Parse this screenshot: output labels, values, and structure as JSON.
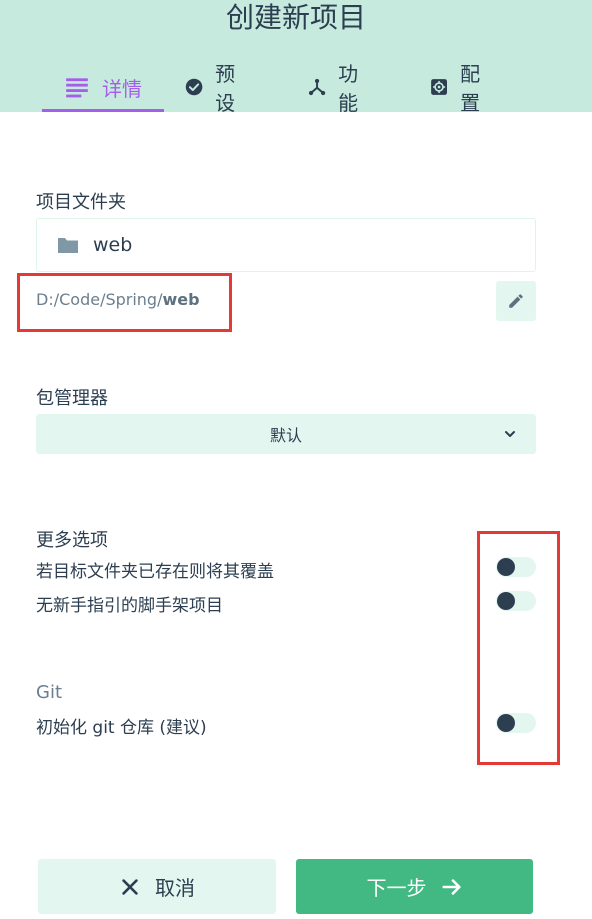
{
  "header": {
    "title": "创建新项目",
    "tabs": [
      {
        "label": "详情",
        "icon": "list-icon",
        "active": true
      },
      {
        "label": "预设",
        "icon": "check-circle-icon",
        "active": false
      },
      {
        "label": "功能",
        "icon": "branch-icon",
        "active": false
      },
      {
        "label": "配置",
        "icon": "settings-icon",
        "active": false
      }
    ]
  },
  "folder": {
    "section_label": "项目文件夹",
    "value": "web",
    "path_prefix": "D:/Code/Spring/",
    "path_name": "web"
  },
  "package_manager": {
    "section_label": "包管理器",
    "selected": "默认"
  },
  "more_options": {
    "section_label": "更多选项",
    "items": [
      {
        "label": "若目标文件夹已存在则将其覆盖",
        "enabled": false
      },
      {
        "label": "无新手指引的脚手架项目",
        "enabled": false
      }
    ]
  },
  "git": {
    "section_label": "Git",
    "items": [
      {
        "label": "初始化 git 仓库 (建议)",
        "enabled": false
      }
    ]
  },
  "actions": {
    "cancel_label": "取消",
    "next_label": "下一步"
  },
  "colors": {
    "header_bg": "#c6ebde",
    "accent": "#a55eea",
    "primary": "#42b983",
    "light": "#e3f6ef",
    "text": "#2c3e50",
    "highlight": "#e53935"
  }
}
